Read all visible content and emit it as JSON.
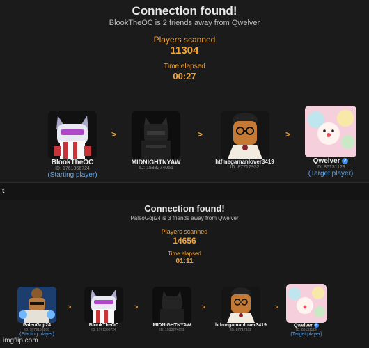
{
  "panel1": {
    "title": "Connection found!",
    "subtitle": "BlookTheOC is 2 friends away from Qwelver",
    "players_scanned_label": "Players scanned",
    "players_scanned_value": "11304",
    "time_elapsed_label": "Time elapsed",
    "time_elapsed_value": "00:27",
    "separator": ">",
    "players": [
      {
        "name": "BlookTheOC",
        "id": "ID: 1761356724",
        "role": "(Starting player)",
        "avatar": "cat-hood-avatar"
      },
      {
        "name": "MIDNIGHTNYAW",
        "id": "ID: 1538274051",
        "role": "",
        "avatar": "dark-avatar"
      },
      {
        "name": "htfmegamanlover3419",
        "id": "ID: 87717932",
        "role": "",
        "avatar": "sunglasses-avatar"
      },
      {
        "name": "Qwelver",
        "id": "ID: 86131129",
        "role": "(Target player)",
        "avatar": "pastel-avatar"
      }
    ]
  },
  "header_strip": {
    "text": "t"
  },
  "panel2": {
    "title": "Connection found!",
    "subtitle": "PaleoGoji24 is 3 friends away from Qwelver",
    "players_scanned_label": "Players scanned",
    "players_scanned_value": "14656",
    "time_elapsed_label": "Time elapsed",
    "time_elapsed_value": "01:11",
    "separator": ">",
    "players": [
      {
        "name": "PaleoGoji24",
        "id": "ID: 3779153266",
        "role": "(Starting player)",
        "avatar": "monkey-avatar"
      },
      {
        "name": "BlookTheOC",
        "id": "ID: 1761356724",
        "role": "",
        "avatar": "cat-hood-avatar"
      },
      {
        "name": "MIDNIGHTNYAW",
        "id": "ID: 1538274051",
        "role": "",
        "avatar": "dark-avatar"
      },
      {
        "name": "htfmegamanlover3419",
        "id": "ID: 87717932",
        "role": "",
        "avatar": "sunglasses-avatar"
      },
      {
        "name": "Qwelver",
        "id": "ID: 86131129",
        "role": "(Target player)",
        "avatar": "pastel-avatar"
      }
    ]
  },
  "watermark": "imgflip.com",
  "colors": {
    "accent": "#f3a432",
    "role_blue": "#5aa8f5",
    "verified": "#3d8bf2"
  }
}
